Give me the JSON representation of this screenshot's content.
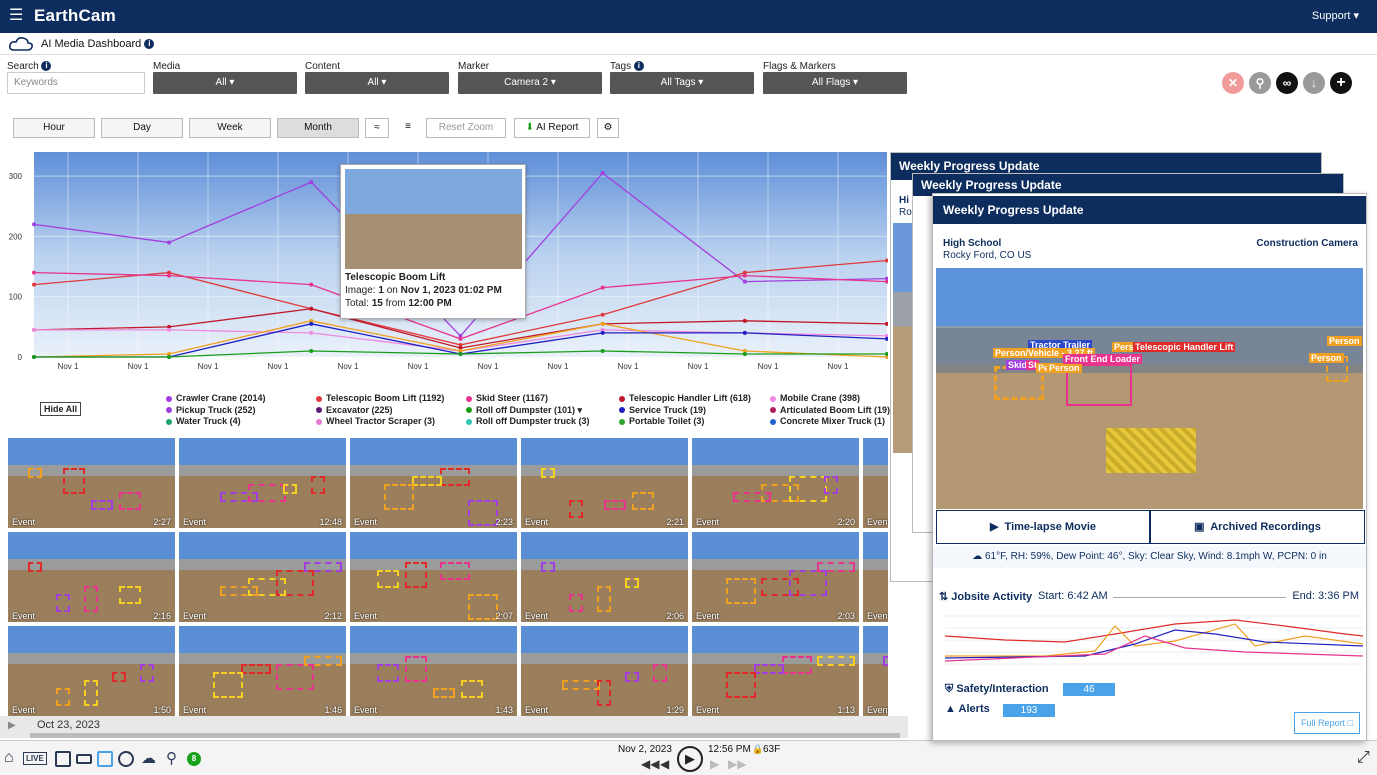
{
  "header": {
    "logo": "EarthCam",
    "support": "Support ▾"
  },
  "subheader": {
    "title": "AI Media Dashboard"
  },
  "filters": {
    "search_label": "Search",
    "search_placeholder": "Keywords",
    "media_label": "Media",
    "media_value": "All ▾",
    "content_label": "Content",
    "content_value": "All ▾",
    "marker_label": "Marker",
    "marker_value": "Camera 2 ▾",
    "tags_label": "Tags",
    "tags_value": "All Tags ▾",
    "flags_label": "Flags & Markers",
    "flags_value": "All Flags ▾"
  },
  "toolbar": {
    "hour": "Hour",
    "day": "Day",
    "week": "Week",
    "month": "Month",
    "reset_zoom": "Reset Zoom",
    "ai_report": "AI Report"
  },
  "chart_data": {
    "type": "line",
    "categories": [
      "Nov 1",
      "Nov 1",
      "Nov 1",
      "Nov 1",
      "Nov 1",
      "Nov 1",
      "Nov 1",
      "Nov 1",
      "Nov 1",
      "Nov 1",
      "Nov 1",
      "Nov 1"
    ],
    "yticks": [
      "0",
      "100",
      "200",
      "300"
    ],
    "ylim": [
      0,
      340
    ],
    "x": [
      0,
      1.9,
      3.9,
      6.0,
      8.0,
      10.0,
      12.0
    ],
    "series": [
      {
        "name": "Crawler Crane (2014)",
        "color": "#a23ee0",
        "values": [
          220,
          190,
          290,
          35,
          305,
          125,
          130
        ]
      },
      {
        "name": "Telescopic Boom Lift (1192)",
        "color": "#e03a3a",
        "values": [
          120,
          140,
          80,
          20,
          70,
          140,
          160
        ]
      },
      {
        "name": "Skid Steer (1167)",
        "color": "#e8348e",
        "values": [
          140,
          135,
          120,
          30,
          115,
          135,
          125
        ]
      },
      {
        "name": "Telescopic Handler Lift (618)",
        "color": "#c0192a",
        "values": [
          45,
          50,
          80,
          15,
          55,
          60,
          55
        ]
      },
      {
        "name": "Mobile Crane (398)",
        "color": "#ee8ae0",
        "values": [
          45,
          45,
          40,
          10,
          45,
          40,
          35
        ]
      },
      {
        "name": "Pickup Truck (252)",
        "color": "#f0a020",
        "values": [
          0,
          5,
          60,
          10,
          55,
          10,
          0
        ]
      },
      {
        "name": "Service Truck (19)",
        "color": "#2020c0",
        "values": [
          0,
          0,
          55,
          5,
          40,
          40,
          30
        ]
      },
      {
        "name": "Roll off Dumpster (101)",
        "color": "#1a9e1a",
        "values": [
          0,
          0,
          10,
          5,
          10,
          5,
          5
        ]
      }
    ]
  },
  "tooltip": {
    "title": "Telescopic Boom Lift",
    "image_label": "Image:",
    "image_num": "1",
    "on": "on",
    "datetime": "Nov 1, 2023 01:02 PM",
    "total_label": "Total:",
    "total": "15",
    "from": "from",
    "time": "12:00 PM"
  },
  "legend": {
    "hide_all": "Hide All",
    "items": [
      {
        "label": "Crawler Crane (2014)",
        "color": "#a23ee0"
      },
      {
        "label": "Pickup Truck (252)",
        "color": "#a23ee0"
      },
      {
        "label": "Water Truck (4)",
        "color": "#1aa36a"
      },
      {
        "label": "Telescopic Boom Lift (1192)",
        "color": "#e03a3a"
      },
      {
        "label": "Excavator (225)",
        "color": "#5b1a7a"
      },
      {
        "label": "Wheel Tractor Scraper (3)",
        "color": "#e87ad0"
      },
      {
        "label": "Skid Steer (1167)",
        "color": "#e8348e"
      },
      {
        "label": "Roll off Dumpster (101) ▾",
        "color": "#1a9e1a"
      },
      {
        "label": "Roll off Dumpster truck (3)",
        "color": "#2ec6b0"
      },
      {
        "label": "Telescopic Handler Lift (618)",
        "color": "#c0192a"
      },
      {
        "label": "Service Truck (19)",
        "color": "#2020c0"
      },
      {
        "label": "Portable Toilet (3)",
        "color": "#2ea62e"
      },
      {
        "label": "Mobile Crane (398)",
        "color": "#ee8ae0"
      },
      {
        "label": "Articulated Boom Lift (19)",
        "color": "#b02060"
      },
      {
        "label": "Concrete Mixer Truck (1)",
        "color": "#2060d0"
      }
    ]
  },
  "thumbnails": [
    {
      "label": "Event",
      "time": "2:27"
    },
    {
      "label": "Event",
      "time": "12:48"
    },
    {
      "label": "Event",
      "time": "2:23"
    },
    {
      "label": "Event",
      "time": "2:21"
    },
    {
      "label": "Event",
      "time": "2:20"
    },
    {
      "label": "Event",
      "time": ""
    },
    {
      "label": "Event",
      "time": "2:16"
    },
    {
      "label": "Event",
      "time": "2:12"
    },
    {
      "label": "Event",
      "time": "2:07"
    },
    {
      "label": "Event",
      "time": "2:06"
    },
    {
      "label": "Event",
      "time": "2:03"
    },
    {
      "label": "Event",
      "time": ""
    },
    {
      "label": "Event",
      "time": "1:50"
    },
    {
      "label": "Event",
      "time": "1:46"
    },
    {
      "label": "Event",
      "time": "1:43"
    },
    {
      "label": "Event",
      "time": "1:29"
    },
    {
      "label": "Event",
      "time": "1:13"
    },
    {
      "label": "Event",
      "time": ""
    }
  ],
  "timeline": {
    "start_date": "Oct 23, 2023"
  },
  "player": {
    "date": "Nov 2, 2023",
    "time": "12:56 PM",
    "temp": "63F",
    "live": "LIVE",
    "badge": "8"
  },
  "report": {
    "back_title_1": "Weekly Progress Update",
    "back_title_2": "Weekly Progress Update",
    "back_hi": "Hi",
    "back_ro": "Ro",
    "title": "Weekly Progress Update",
    "site": "High School",
    "location": "Rocky Ford, CO US",
    "camera": "Construction Camera",
    "photo_tags": [
      {
        "text": "Tractor Trailer",
        "color": "#2a48c8"
      },
      {
        "text": "Person/Vehicle - 3.27 ft",
        "color": "#f0a020"
      },
      {
        "text": "Person",
        "color": "#f0a020"
      },
      {
        "text": "Telescopic Handler Lift",
        "color": "#e02a2a"
      },
      {
        "text": "Person",
        "color": "#f0a020"
      },
      {
        "text": "Skid",
        "color": "#a23ee0"
      },
      {
        "text": "St",
        "color": "#e8348e"
      },
      {
        "text": "Pe",
        "color": "#f0a020"
      },
      {
        "text": "Person",
        "color": "#f0a020"
      },
      {
        "text": "Front End Loader",
        "color": "#e8348e"
      },
      {
        "text": "Person",
        "color": "#f0a020"
      }
    ],
    "timelapse": "Time-lapse Movie",
    "archived": "Archived Recordings",
    "weather": "61°F, RH: 59%, Dew Point: 46°, Sky: Clear Sky, Wind: 8.1mph W, PCPN: 0 in",
    "activity_title": "Jobsite Activity",
    "start": "Start: 6:42 AM",
    "end": "End: 3:36 PM",
    "safety_label": "Safety/Interaction",
    "safety_value": "46",
    "alerts_label": "Alerts",
    "alerts_value": "193",
    "full_report": "Full Report"
  }
}
